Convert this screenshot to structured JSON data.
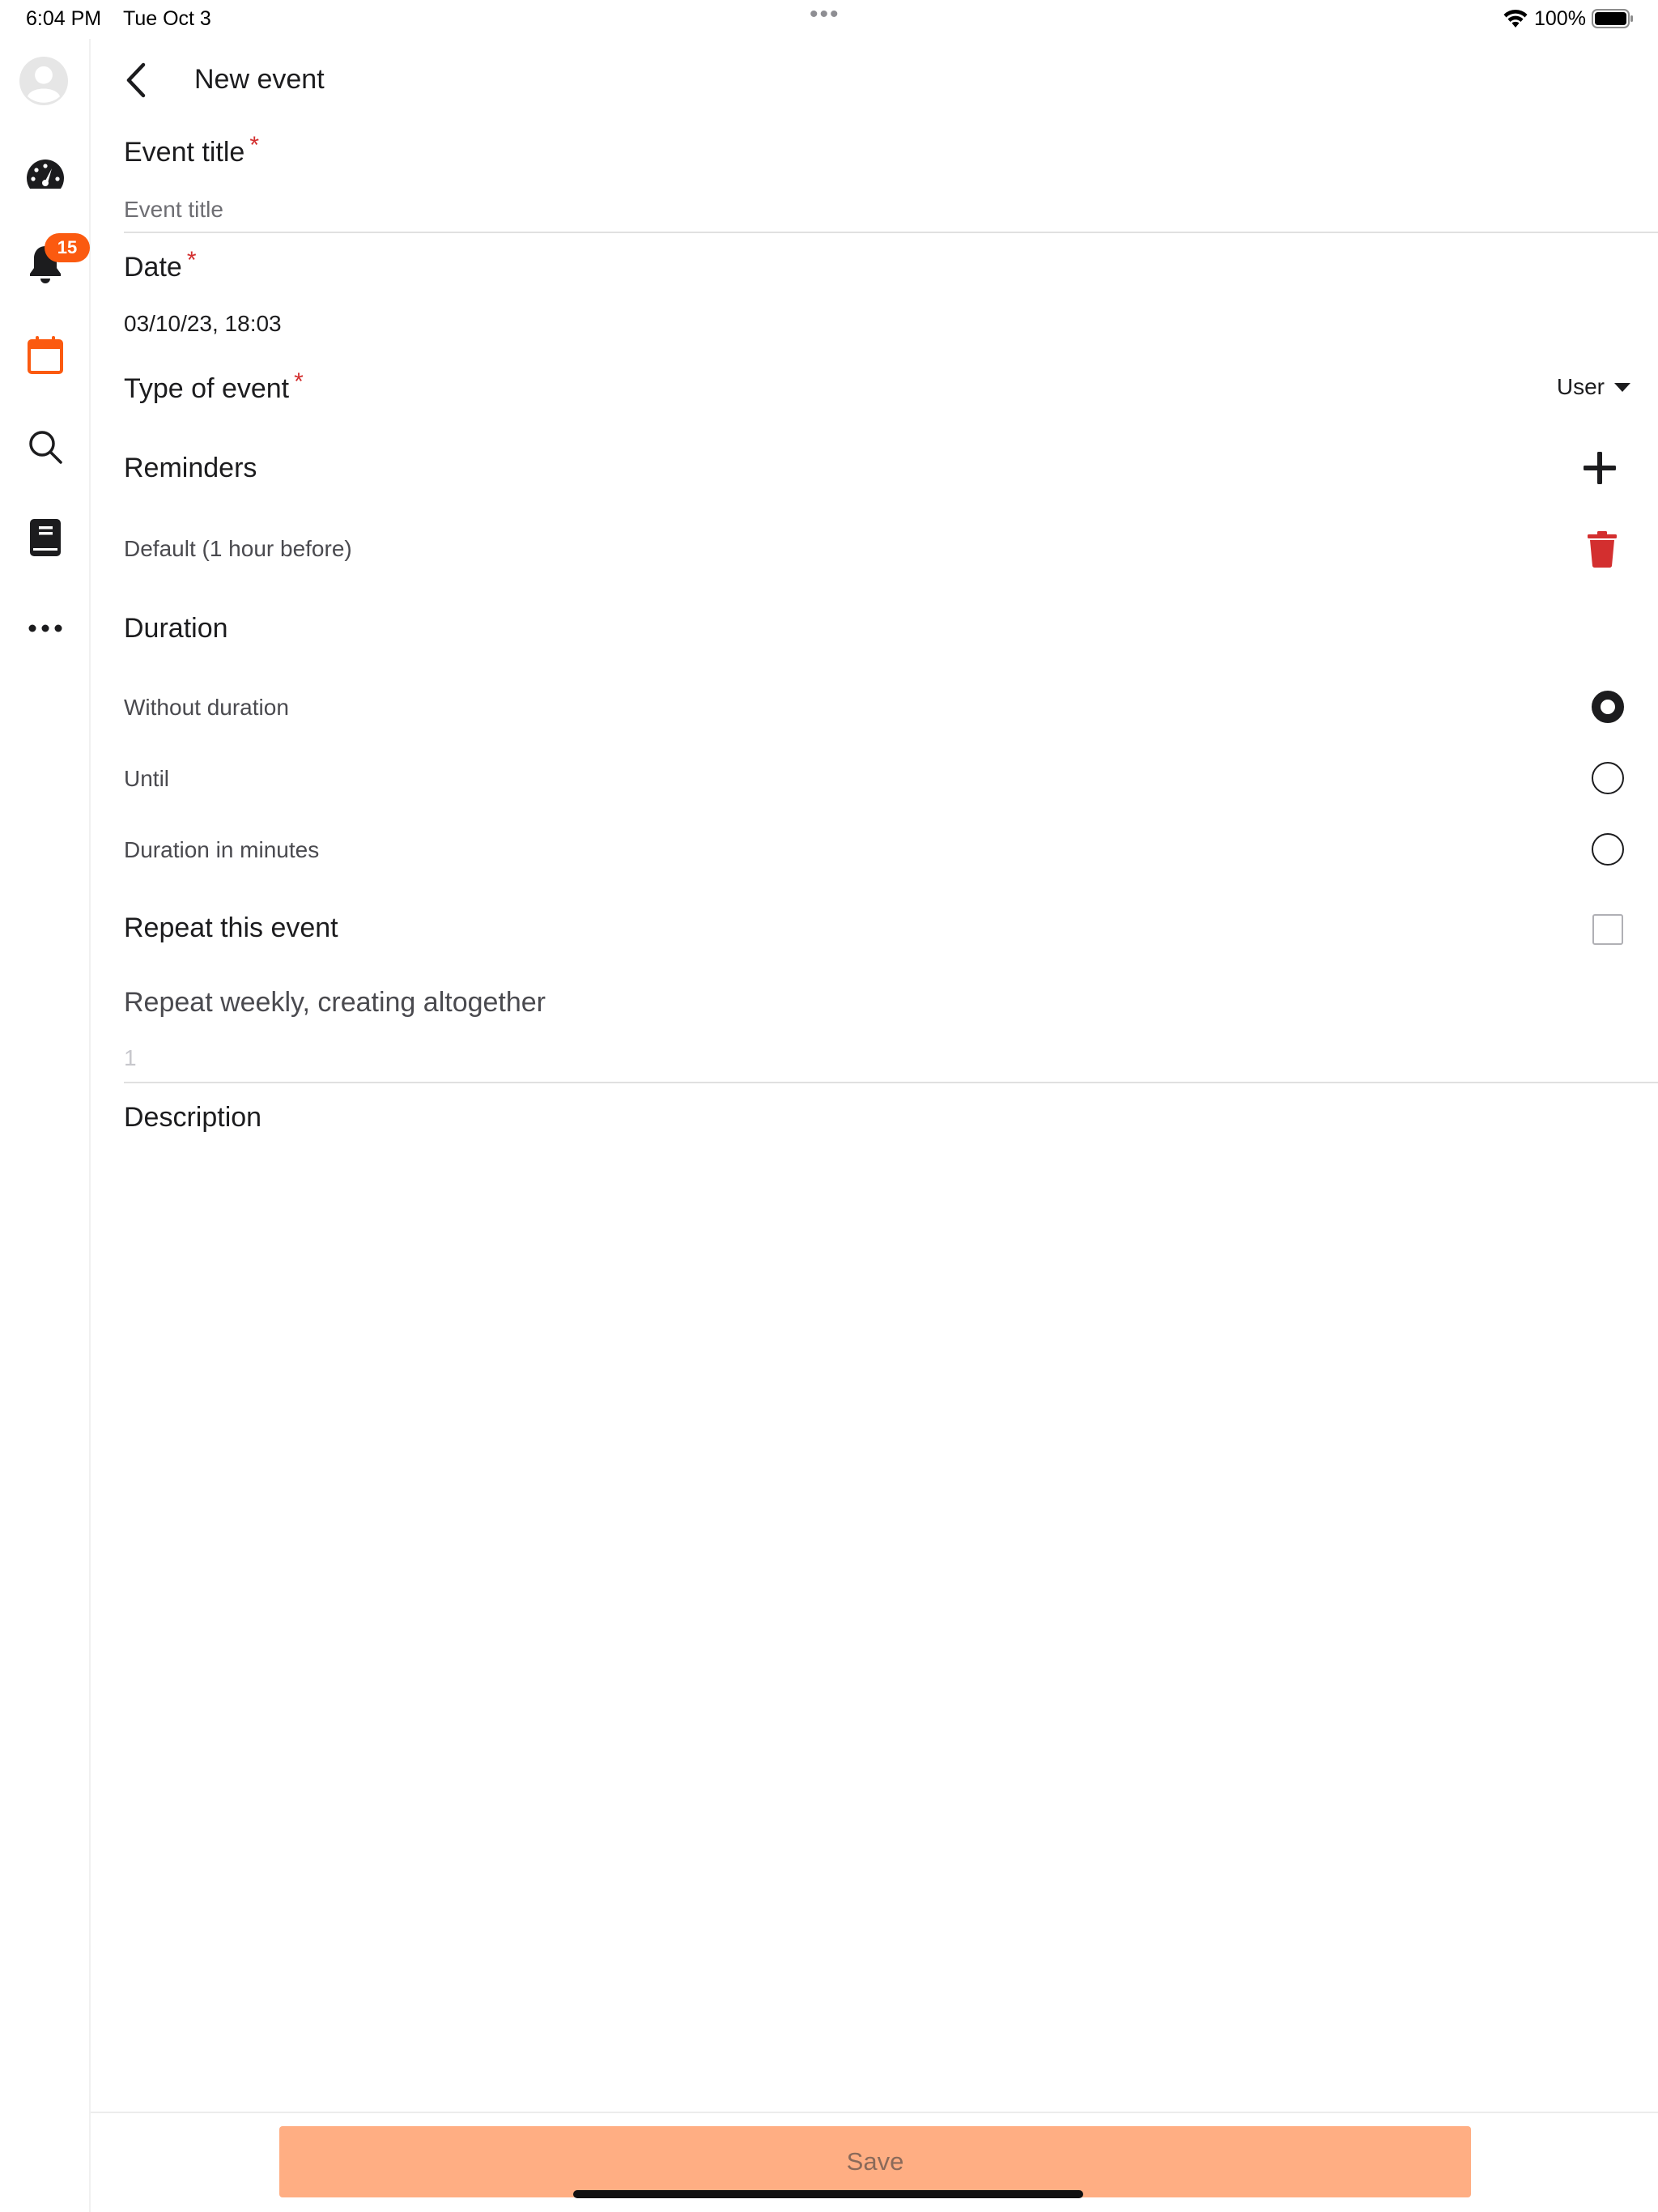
{
  "status_bar": {
    "time": "6:04 PM",
    "date": "Tue Oct 3",
    "dots": "•••",
    "battery": "100%"
  },
  "sidebar": {
    "items": [
      {
        "name": "avatar",
        "icon": "user-avatar-icon"
      },
      {
        "name": "dashboard",
        "icon": "speedometer-icon"
      },
      {
        "name": "notifications",
        "icon": "bell-icon",
        "badge": "15"
      },
      {
        "name": "calendar",
        "icon": "calendar-icon",
        "active": true
      },
      {
        "name": "search",
        "icon": "search-icon"
      },
      {
        "name": "book",
        "icon": "book-icon"
      },
      {
        "name": "more",
        "icon": "more-dots-icon"
      }
    ],
    "badge_count": "15",
    "accent_color": "#fb5a10"
  },
  "header": {
    "title": "New event"
  },
  "form": {
    "event_title": {
      "label": "Event title",
      "required_mark": "*",
      "placeholder": "Event title",
      "value": ""
    },
    "date": {
      "label": "Date",
      "required_mark": "*",
      "value": "03/10/23, 18:03"
    },
    "type_of_event": {
      "label": "Type of event",
      "required_mark": "*",
      "selected": "User"
    },
    "reminders": {
      "label": "Reminders",
      "items": [
        "Default (1 hour before)"
      ]
    },
    "duration": {
      "label": "Duration",
      "options": [
        "Without duration",
        "Until",
        "Duration in minutes"
      ],
      "selected_index": 0
    },
    "repeat": {
      "label": "Repeat this event",
      "checked": false,
      "weekly_label": "Repeat weekly, creating altogether",
      "count_placeholder": "1"
    },
    "description": {
      "label": "Description"
    }
  },
  "footer": {
    "save_label": "Save",
    "save_color": "#ffae83"
  }
}
